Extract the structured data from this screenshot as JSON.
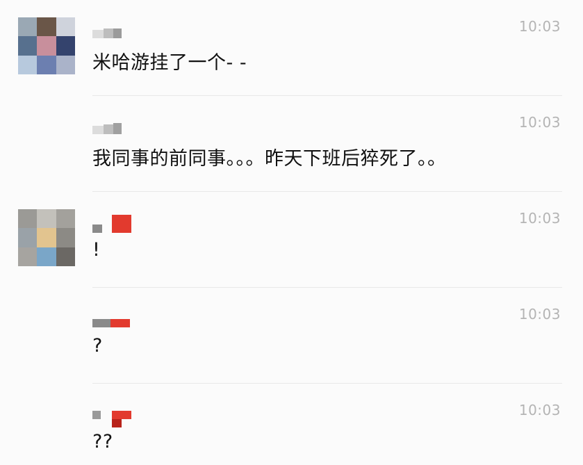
{
  "chat": {
    "messages": [
      {
        "time": "10:03",
        "text": "米哈游挂了一个- -",
        "has_avatar": true
      },
      {
        "time": "10:03",
        "text": "我同事的前同事。。。昨天下班后猝死了。。",
        "has_avatar": false
      },
      {
        "time": "10:03",
        "text": "!",
        "has_avatar": true
      },
      {
        "time": "10:03",
        "text": "?",
        "has_avatar": false
      },
      {
        "time": "10:03",
        "text": "??",
        "has_avatar": false
      }
    ]
  },
  "colors": {
    "background": "#fbfbfb",
    "timestamp": "#b4b4b4",
    "message_text": "#111111",
    "divider": "#e8e8e8",
    "name_red": "#e23a2e",
    "name_gray": "#8a8a8a"
  },
  "icons": {
    "avatar_1": "pixelated-avatar",
    "avatar_3": "pixelated-avatar"
  }
}
